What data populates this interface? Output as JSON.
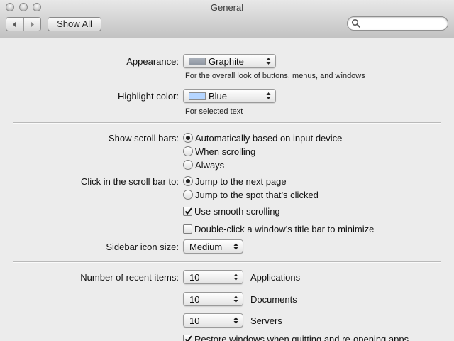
{
  "window": {
    "title": "General"
  },
  "toolbar": {
    "back_icon": "chevron-left-icon",
    "forward_icon": "chevron-right-icon",
    "show_all_label": "Show All",
    "search_placeholder": "",
    "search_value": ""
  },
  "appearance": {
    "label": "Appearance:",
    "value": "Graphite",
    "hint": "For the overall look of buttons, menus, and windows",
    "swatch_color": "#a9b0ba"
  },
  "highlight": {
    "label": "Highlight color:",
    "value": "Blue",
    "hint": "For selected text",
    "swatch_color": "#b5d5ff"
  },
  "scroll_bars": {
    "label": "Show scroll bars:",
    "options": [
      {
        "label": "Automatically based on input device",
        "selected": true
      },
      {
        "label": "When scrolling",
        "selected": false
      },
      {
        "label": "Always",
        "selected": false
      }
    ]
  },
  "click_scroll": {
    "label": "Click in the scroll bar to:",
    "options": [
      {
        "label": "Jump to the next page",
        "selected": true
      },
      {
        "label": "Jump to the spot that’s clicked",
        "selected": false
      }
    ]
  },
  "smooth_scrolling": {
    "label": "Use smooth scrolling",
    "checked": true
  },
  "double_click": {
    "label": "Double-click a window’s title bar to minimize",
    "checked": false
  },
  "sidebar_icon_size": {
    "label": "Sidebar icon size:",
    "value": "Medium"
  },
  "recent_items": {
    "label": "Number of recent items:",
    "rows": [
      {
        "value": "10",
        "label": "Applications"
      },
      {
        "value": "10",
        "label": "Documents"
      },
      {
        "value": "10",
        "label": "Servers"
      }
    ]
  },
  "restore_windows": {
    "label": "Restore windows when quitting and re-opening apps",
    "checked": true
  }
}
